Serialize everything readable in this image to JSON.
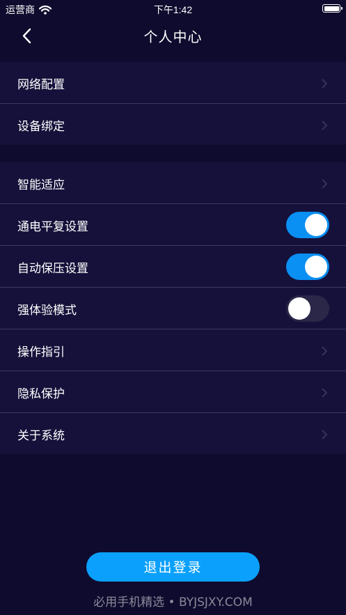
{
  "status_bar": {
    "carrier": "运营商",
    "time": "下午1:42"
  },
  "header": {
    "title": "个人中心",
    "back_icon": "chevron-left-icon"
  },
  "settings_group_1": [
    {
      "label": "网络配置",
      "control": "chevron"
    },
    {
      "label": "设备绑定",
      "control": "chevron"
    }
  ],
  "settings_group_2": [
    {
      "label": "智能适应",
      "control": "chevron"
    },
    {
      "label": "通电平复设置",
      "control": "toggle",
      "checked": true
    },
    {
      "label": "自动保压设置",
      "control": "toggle",
      "checked": true
    },
    {
      "label": "强体验模式",
      "control": "toggle",
      "checked": false
    },
    {
      "label": "操作指引",
      "control": "chevron"
    },
    {
      "label": "隐私保护",
      "control": "chevron"
    },
    {
      "label": "关于系统",
      "control": "chevron"
    }
  ],
  "logout_label": "退出登录",
  "watermark": "必用手机精选 • BYJSJXY.COM",
  "colors": {
    "background": "#0f0b2e",
    "group_background": "#15113a",
    "accent": "#0a8ff3",
    "button": "#0aa0fc"
  }
}
